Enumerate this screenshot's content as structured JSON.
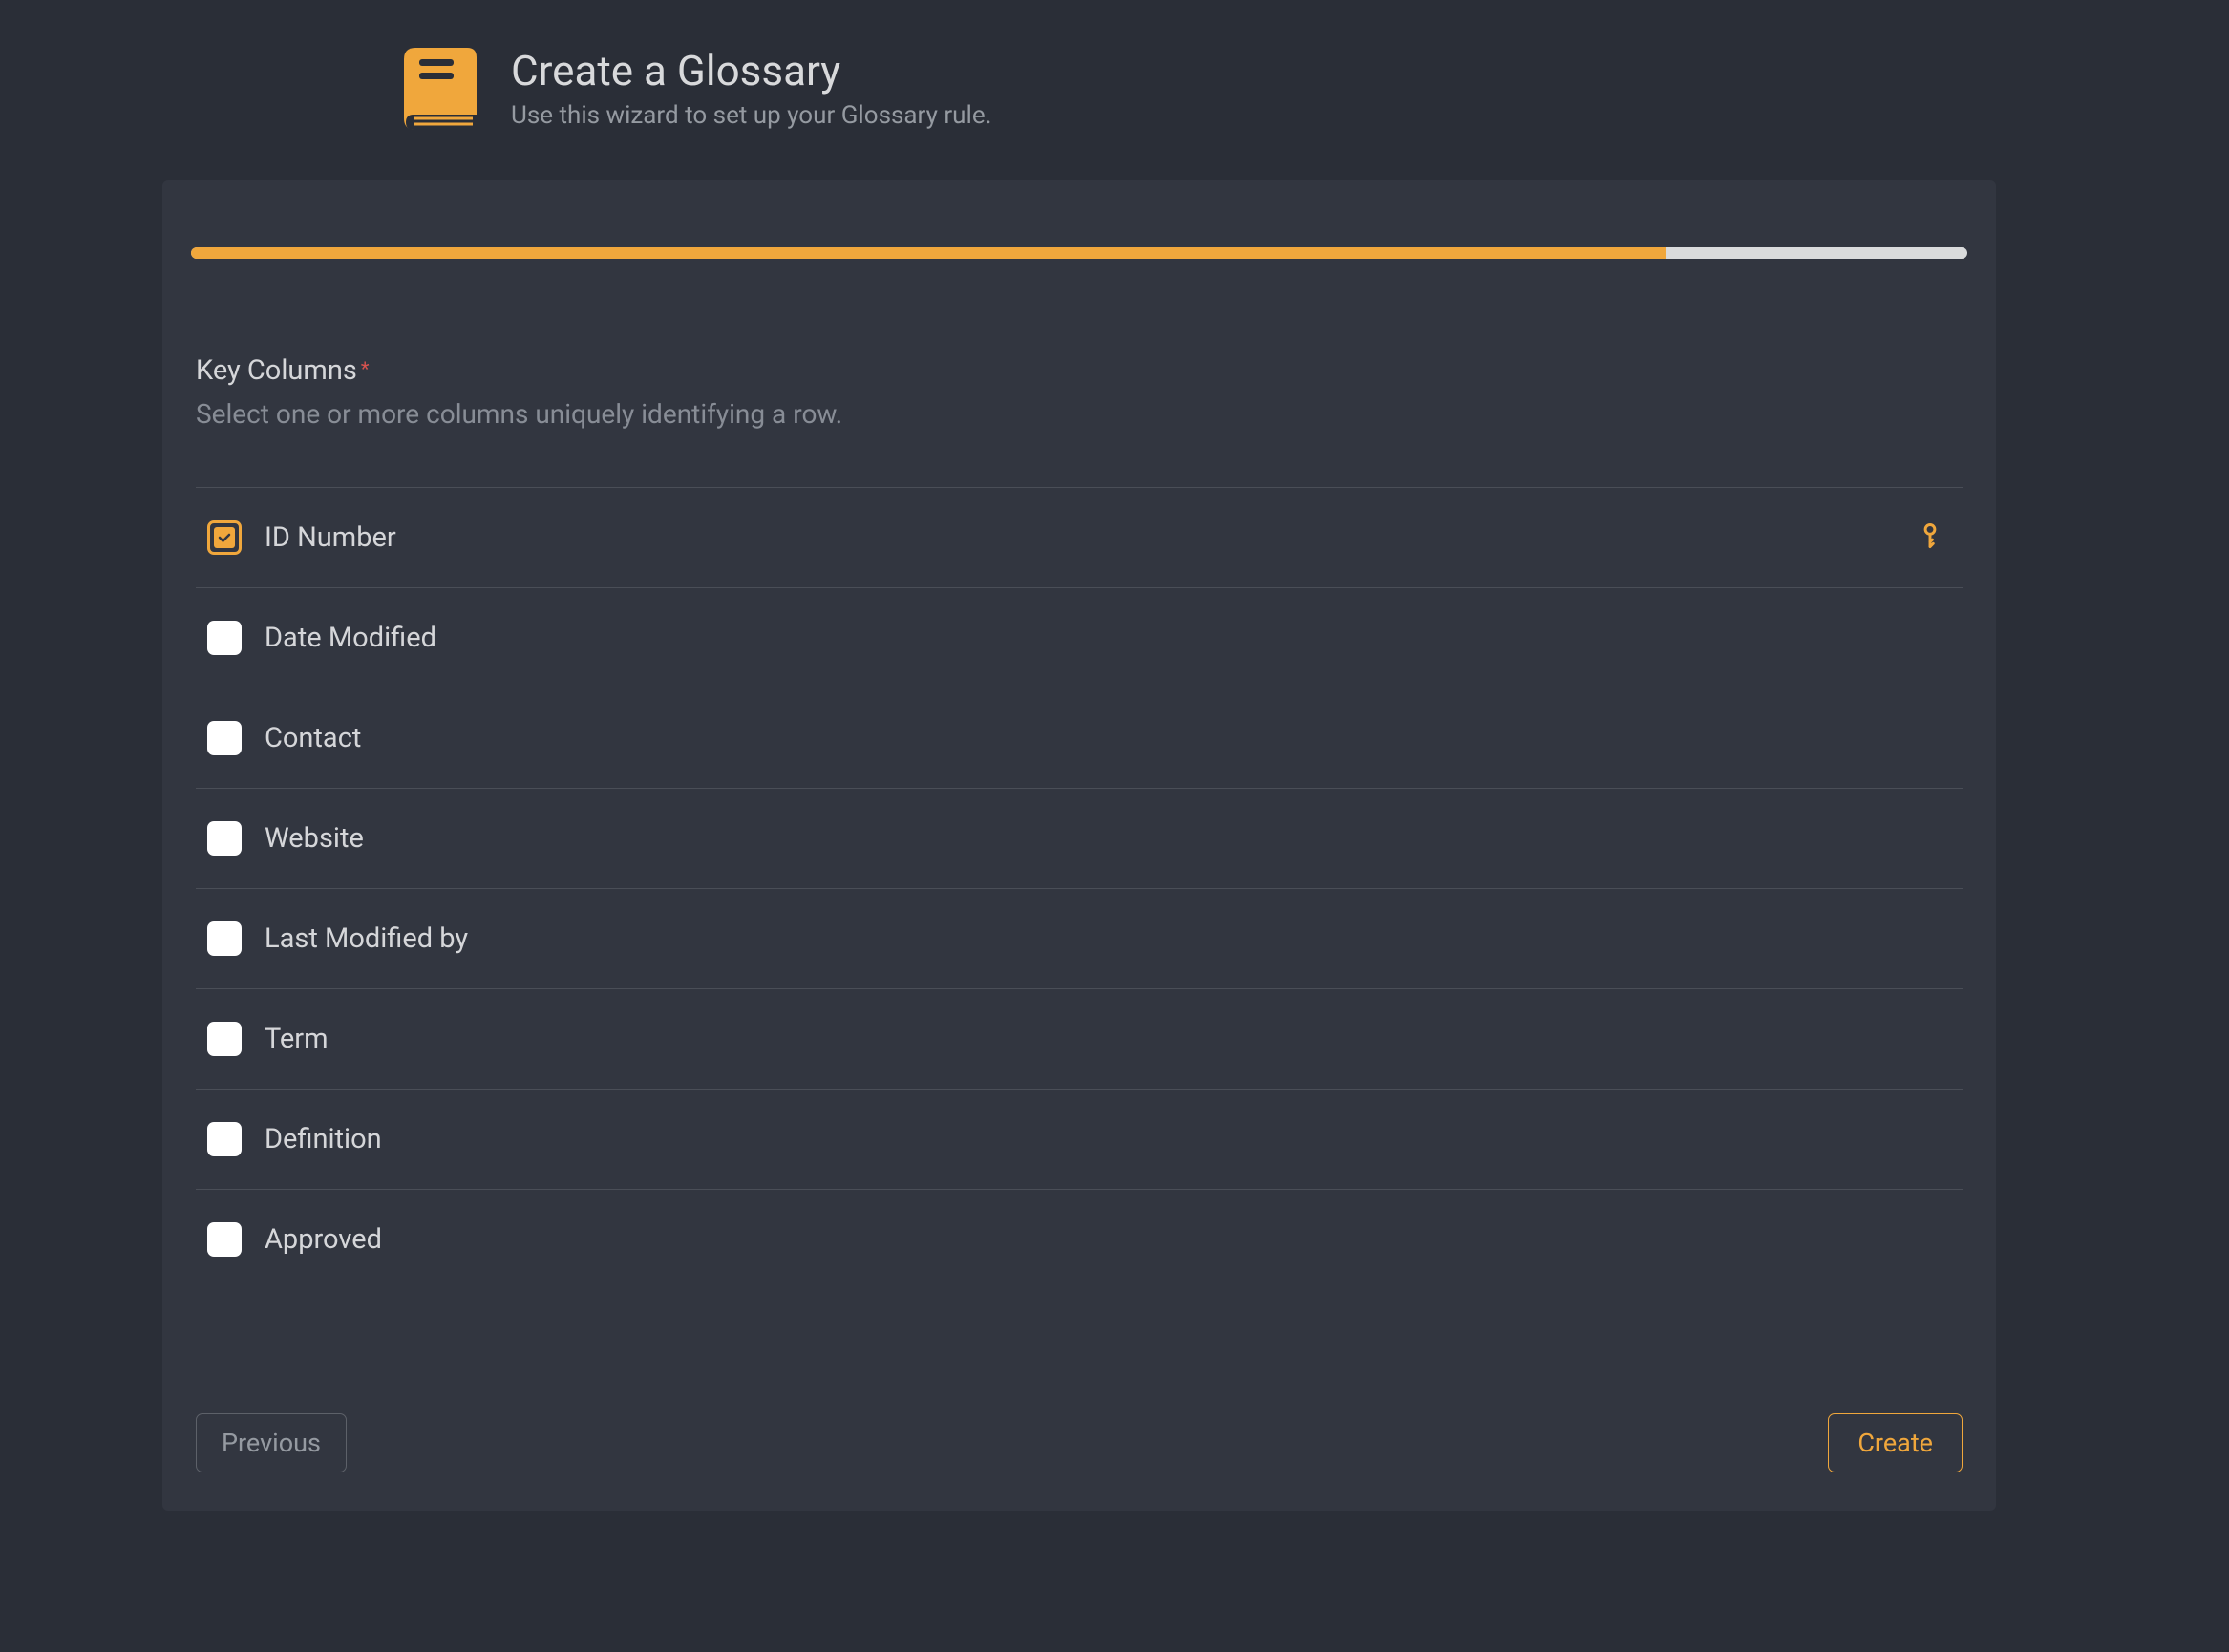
{
  "header": {
    "title": "Create a Glossary",
    "subtitle": "Use this wizard to set up your Glossary rule."
  },
  "progress": {
    "percent": 83
  },
  "section": {
    "title": "Key Columns",
    "required": true,
    "subtitle": "Select one or more columns uniquely identifying a row."
  },
  "columns": [
    {
      "label": "ID Number",
      "checked": true,
      "keyed": true
    },
    {
      "label": "Date Modified",
      "checked": false,
      "keyed": false
    },
    {
      "label": "Contact",
      "checked": false,
      "keyed": false
    },
    {
      "label": "Website",
      "checked": false,
      "keyed": false
    },
    {
      "label": "Last Modified by",
      "checked": false,
      "keyed": false
    },
    {
      "label": "Term",
      "checked": false,
      "keyed": false
    },
    {
      "label": "Definition",
      "checked": false,
      "keyed": false
    },
    {
      "label": "Approved",
      "checked": false,
      "keyed": false
    }
  ],
  "footer": {
    "previous": "Previous",
    "create": "Create"
  },
  "colors": {
    "accent": "#f0a73c",
    "bgDark": "#2a2e37",
    "bgCard": "#323640"
  }
}
